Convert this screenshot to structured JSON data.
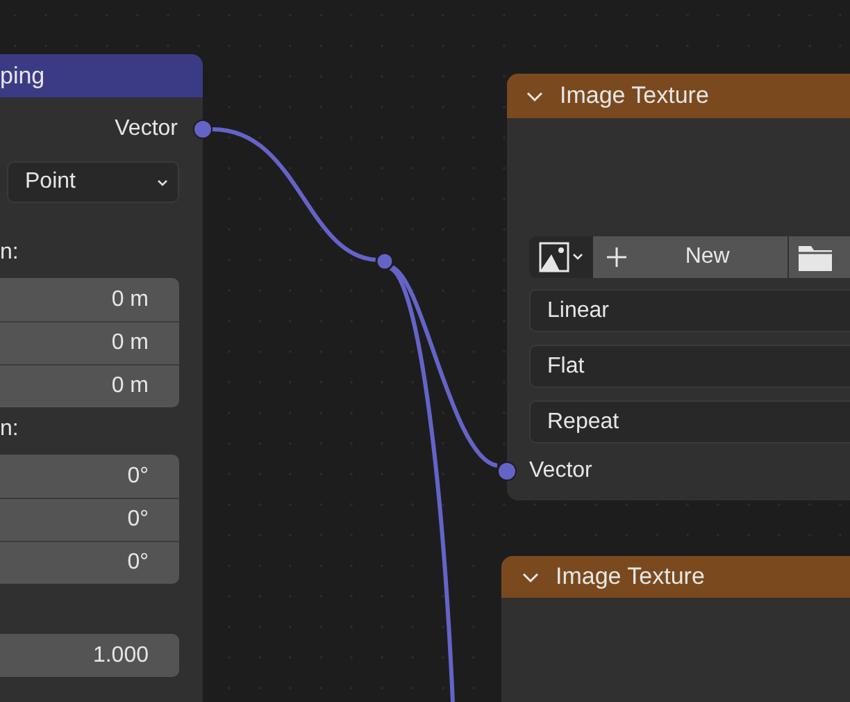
{
  "mapping_node": {
    "title": "ping",
    "output": "Vector",
    "type_dropdown": "Point",
    "location_label": "n:",
    "location": [
      "0 m",
      "0 m",
      "0 m"
    ],
    "rotation_label": "n:",
    "rotation": [
      "0°",
      "0°",
      "0°"
    ],
    "scale": [
      "1.000"
    ]
  },
  "image_nodes": [
    {
      "title": "Image Texture",
      "expanded": true,
      "new_button": "New",
      "dropdowns": [
        "Linear",
        "Flat",
        "Repeat"
      ],
      "input": "Vector"
    },
    {
      "title": "Image Texture",
      "expanded": true
    }
  ]
}
